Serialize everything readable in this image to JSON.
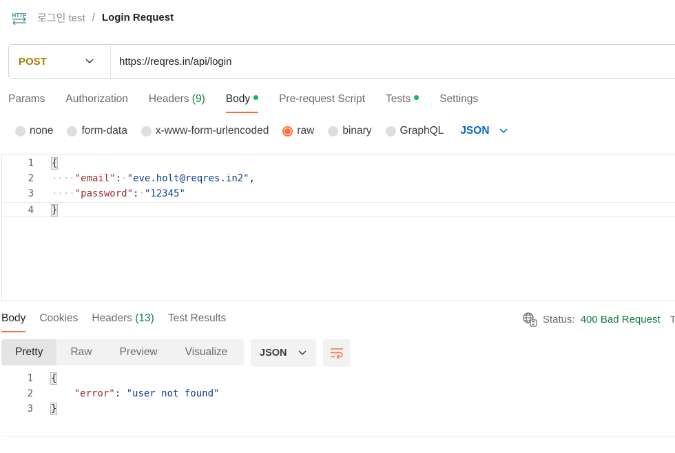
{
  "breadcrumb": {
    "icon": "http-icon",
    "parent": "로그인 test",
    "separator": "/",
    "current": "Login Request"
  },
  "request": {
    "method": "POST",
    "url": "https://reqres.in/api/login"
  },
  "request_tabs": [
    {
      "label": "Params",
      "count": ""
    },
    {
      "label": "Authorization",
      "count": ""
    },
    {
      "label": "Headers",
      "count": "(9)"
    },
    {
      "label": "Body",
      "count": "",
      "active": true,
      "dot": true
    },
    {
      "label": "Pre-request Script",
      "count": ""
    },
    {
      "label": "Tests",
      "count": "",
      "dot": true
    },
    {
      "label": "Settings",
      "count": ""
    }
  ],
  "body_types": [
    "none",
    "form-data",
    "x-www-form-urlencoded",
    "raw",
    "binary",
    "GraphQL"
  ],
  "body_type_selected": "raw",
  "body_format": "JSON",
  "request_body": {
    "line_numbers": [
      "1",
      "2",
      "3",
      "4"
    ],
    "open_brace": "{",
    "close_brace": "}",
    "email_key": "\"email\"",
    "email_value": "\"eve.holt@reqres.in2\"",
    "password_key": "\"password\"",
    "password_value": "\"12345\""
  },
  "response_tabs": [
    {
      "label": "Body",
      "count": "",
      "active": true
    },
    {
      "label": "Cookies",
      "count": ""
    },
    {
      "label": "Headers",
      "count": "(13)"
    },
    {
      "label": "Test Results",
      "count": ""
    }
  ],
  "status": {
    "label": "Status:",
    "value": "400 Bad Request",
    "trailing": "T"
  },
  "response_views": [
    "Pretty",
    "Raw",
    "Preview",
    "Visualize"
  ],
  "response_view_selected": "Pretty",
  "response_format": "JSON",
  "response_body": {
    "line_numbers": [
      "1",
      "2",
      "3"
    ],
    "open_brace": "{",
    "close_brace": "}",
    "error_key": "\"error\"",
    "error_value": "\"user not found\""
  },
  "colors": {
    "accent": "#ff6c37",
    "method": "#ad7a03",
    "link_blue": "#0265d2",
    "success_green": "#0f7b3f",
    "dot_green": "#0cbb52"
  }
}
